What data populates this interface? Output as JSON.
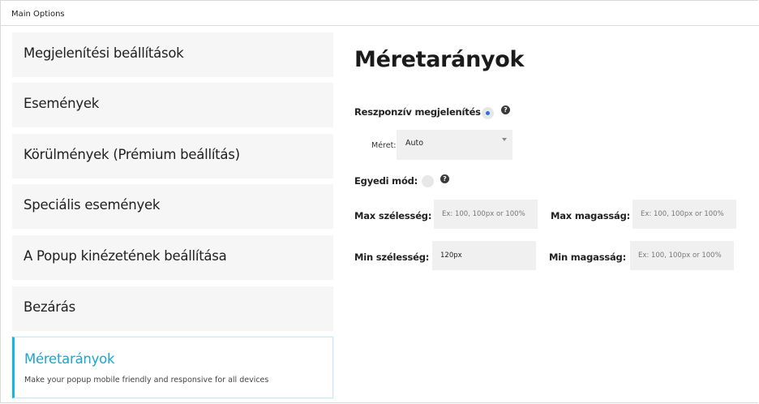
{
  "panel": {
    "title": "Main Options"
  },
  "nav": {
    "items": [
      {
        "label": "Megjelenítési beállítások"
      },
      {
        "label": "Események"
      },
      {
        "label": "Körülmények (Prémium beállítás)"
      },
      {
        "label": "Speciális események"
      },
      {
        "label": "A Popup kinézetének beállítása"
      },
      {
        "label": "Bezárás"
      },
      {
        "label": "Méretarányok",
        "description": "Make your popup mobile friendly and responsive for all devices",
        "active": true
      }
    ]
  },
  "content": {
    "title": "Méretarányok",
    "responsive": {
      "label": "Reszponzív megjelenítés :",
      "checked": true,
      "size_label": "Méret:",
      "size_value": "Auto"
    },
    "custom": {
      "label": "Egyedi mód:",
      "checked": false
    },
    "max_width": {
      "label": "Max szélesség:",
      "placeholder": "Ex: 100, 100px or 100%",
      "value": ""
    },
    "max_height": {
      "label": "Max magasság:",
      "placeholder": "Ex: 100, 100px or 100%",
      "value": ""
    },
    "min_width": {
      "label": "Min szélesség:",
      "placeholder": "Ex: 100, 100px or 100%",
      "value": "120px"
    },
    "min_height": {
      "label": "Min magasság:",
      "placeholder": "Ex: 100, 100px or 100%",
      "value": ""
    },
    "help_glyph": "?"
  },
  "colors": {
    "accent": "#18b4e8",
    "active_text": "#19a6d4",
    "nav_background": "#f6f6f6",
    "field_background": "#f0f0f0",
    "radio_dot": "#2f6fe0"
  }
}
